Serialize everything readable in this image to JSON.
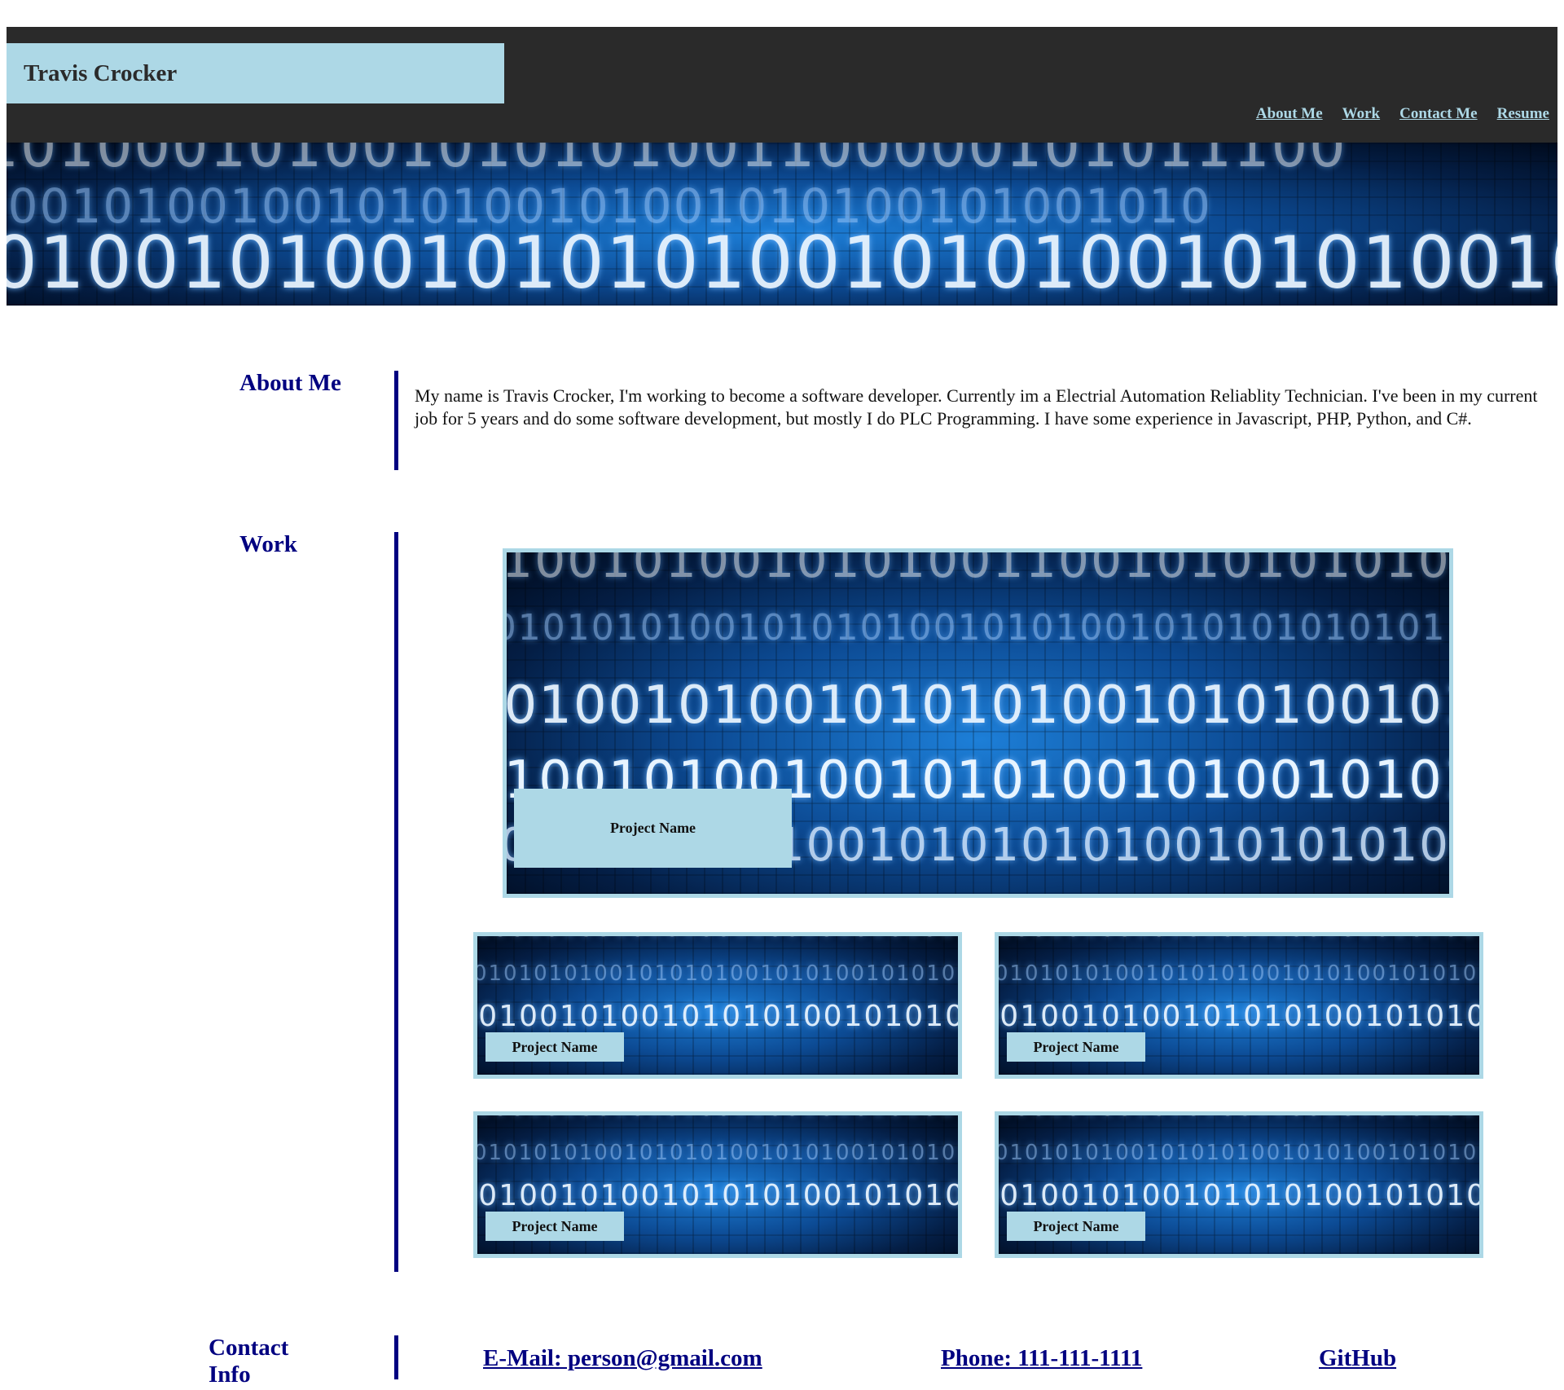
{
  "header": {
    "brand": "Travis Crocker",
    "nav": [
      "About Me",
      "Work",
      "Contact Me",
      "Resume"
    ]
  },
  "banner": {
    "row1": "0101000101001010101001100000101011100",
    "row2": "0100101001001010100101001010100101001010",
    "row3": "1010010100101010100101010010101001010"
  },
  "about": {
    "title": "About Me",
    "text": "My name is Travis Crocker, I'm working to become a software developer. Currently im a Electrial Automation Reliablity Technician. I've been in my current job for 5 years and do some software development, but mostly I do PLC Programming. I have some experience in Javascript, PHP, Python, and C#."
  },
  "work": {
    "title": "Work",
    "projects": [
      {
        "label": "Project Name"
      },
      {
        "label": "Project Name"
      },
      {
        "label": "Project Name"
      },
      {
        "label": "Project Name"
      },
      {
        "label": "Project Name"
      }
    ],
    "art": {
      "r1": "010010100101010011001010101010100101010",
      "r2": "0010101010010101010010101001010101010101",
      "r3": "1010010100101010100101010010101001010101",
      "r4": "0100101001001010100101001010100101010",
      "r5": "00101010101001010101010010101010101"
    }
  },
  "contact": {
    "title_line1": "Contact",
    "title_line2": "Info",
    "email": "E-Mail: person@gmail.com",
    "phone": "Phone: 111-111-1111",
    "github": "GitHub"
  },
  "colors": {
    "header_bg": "#2a2a2a",
    "accent": "#add8e6",
    "heading": "#000080"
  }
}
